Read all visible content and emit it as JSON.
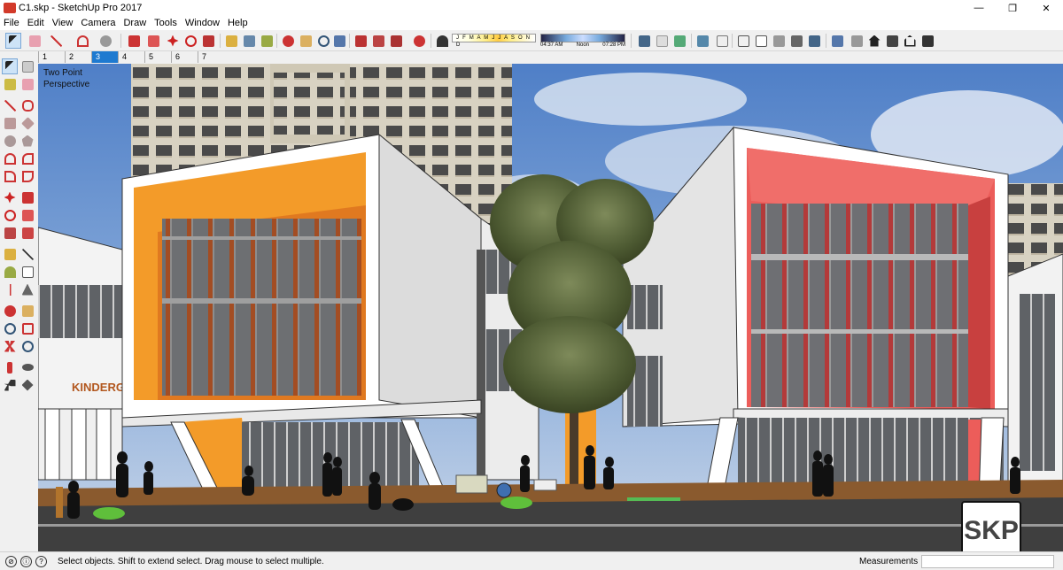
{
  "window": {
    "title": "C1.skp - SketchUp Pro 2017",
    "minimize": "—",
    "maximize": "❐",
    "close": "✕"
  },
  "menu": [
    "File",
    "Edit",
    "View",
    "Camera",
    "Draw",
    "Tools",
    "Window",
    "Help"
  ],
  "shadow": {
    "months": "J F M A M J J A S O N D",
    "time_start": "04:37 AM",
    "time_noon": "Noon",
    "time_end": "07:28 PM"
  },
  "scene_tabs": [
    "1",
    "2",
    "3",
    "4",
    "5",
    "6",
    "7"
  ],
  "active_scene": "3",
  "viewport": {
    "camera_line1": "Two Point",
    "camera_line2": "Perspective",
    "sign": "KINDERGA"
  },
  "badge": "SKP",
  "status": {
    "message": "Select objects. Shift to extend select. Drag mouse to select multiple.",
    "measurements_label": "Measurements"
  },
  "colors": {
    "orange_panel": "#f39b29",
    "red_panel": "#ec5d5a",
    "sky": "#5a8bd0"
  }
}
